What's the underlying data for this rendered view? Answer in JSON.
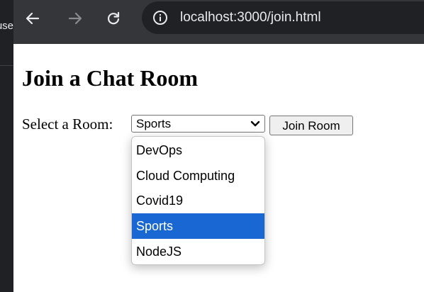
{
  "window": {
    "left_edge_text": "use"
  },
  "browser": {
    "url": "localhost:3000/join.html"
  },
  "page": {
    "title": "Join a Chat Room",
    "select_label": "Select a Room:",
    "selected_room": "Sports",
    "join_button_label": "Join Room",
    "room_options": [
      "DevOps",
      "Cloud Computing",
      "Covid19",
      "Sports",
      "NodeJS"
    ]
  },
  "colors": {
    "toolbar": "#35363a",
    "omnibox": "#202124",
    "selected_option": "#1967d2"
  },
  "icons": [
    "back-arrow-icon",
    "forward-arrow-icon",
    "reload-icon",
    "info-icon",
    "chevron-down-icon"
  ]
}
